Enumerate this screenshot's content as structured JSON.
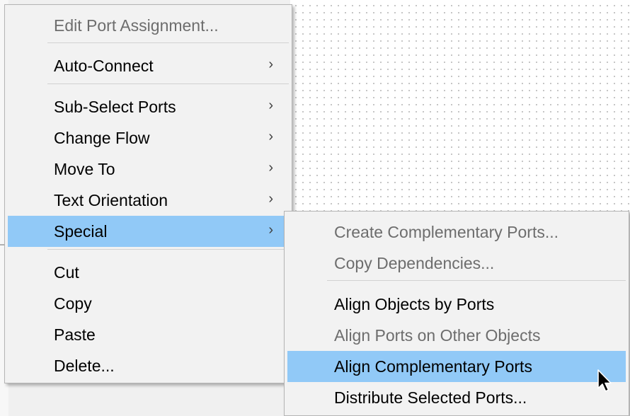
{
  "main_menu": {
    "edit_port_assignment": "Edit Port Assignment...",
    "auto_connect": "Auto-Connect",
    "sub_select_ports": "Sub-Select Ports",
    "change_flow": "Change Flow",
    "move_to": "Move To",
    "text_orientation": "Text Orientation",
    "special": "Special",
    "cut": "Cut",
    "copy": "Copy",
    "paste": "Paste",
    "delete": "Delete..."
  },
  "special_submenu": {
    "create_complementary_ports": "Create Complementary Ports...",
    "copy_dependencies": "Copy Dependencies...",
    "align_objects_by_ports": "Align Objects by Ports",
    "align_ports_on_other_objects": "Align Ports on Other Objects",
    "align_complementary_ports": "Align Complementary Ports",
    "distribute_selected_ports": "Distribute Selected Ports..."
  },
  "icons": {
    "submenu_arrow": "chevron-right-icon",
    "cursor": "mouse-pointer-icon"
  },
  "colors": {
    "highlight": "#91c9f7",
    "menu_background": "#f2f2f2",
    "disabled_text": "#6d6d6d"
  }
}
